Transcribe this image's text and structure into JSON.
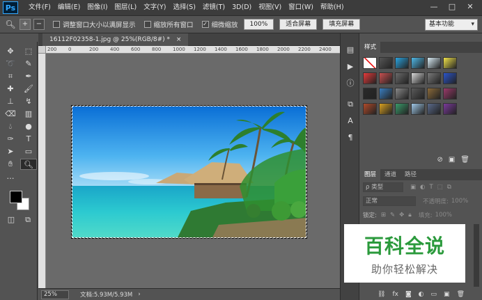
{
  "app": {
    "logo": "Ps"
  },
  "menu": [
    "文件(F)",
    "编辑(E)",
    "图像(I)",
    "图层(L)",
    "文字(Y)",
    "选择(S)",
    "滤镜(T)",
    "3D(D)",
    "视图(V)",
    "窗口(W)",
    "帮助(H)"
  ],
  "window_controls": {
    "minimize": "—",
    "maximize": "□",
    "close": "✕"
  },
  "options": {
    "resize_windows_label": "调整窗口大小以满屏显示",
    "zoom_all_label": "缩放所有窗口",
    "scrubby_zoom_label": "细微缩放",
    "zoom_value": "100%",
    "fit_screen_label": "适合屏幕",
    "fill_screen_label": "填充屏幕",
    "workspace": "基本功能"
  },
  "document": {
    "tab_title": "16112F02358-1.jpg @ 25%(RGB/8#) *",
    "close": "×"
  },
  "ruler": {
    "top_ticks": [
      "200",
      "0",
      "200",
      "400",
      "600",
      "800",
      "1000",
      "1200",
      "1400",
      "1600",
      "1800",
      "2000",
      "2200",
      "2400"
    ]
  },
  "status": {
    "zoom": "25%",
    "doc_info": "文档:5.93M/5.93M"
  },
  "styles_panel": {
    "tab": "样式",
    "swatch_colors": [
      "#ffffff",
      "#555555",
      "#2aa4e0",
      "#4fb9e8",
      "#d9ecf5",
      "#f2e34a",
      "#e53a3a",
      "#c85050",
      "#6a6a6a",
      "#d7d7d7",
      "#7a7a7a",
      "#2b54c9",
      "#2a2a2a",
      "#3a7ec0",
      "#888888",
      "#5a5a5a",
      "#8a6a3a",
      "#9a3a6a",
      "#b04a2a",
      "#d8a020",
      "#3a9a6a",
      "#a0c8e8",
      "#5a6a8a",
      "#7a3a9a"
    ]
  },
  "layers_panel": {
    "tabs": [
      "图层",
      "通道",
      "路径"
    ],
    "kind_filter": "ρ 类型",
    "blend_mode": "正常",
    "opacity_label": "不透明度:",
    "opacity_value": "100%",
    "lock_label": "锁定:",
    "fill_label": "填充:",
    "fill_value": "100%"
  },
  "watermark": {
    "line1": "百科全说",
    "line2": "助你轻松解决"
  }
}
